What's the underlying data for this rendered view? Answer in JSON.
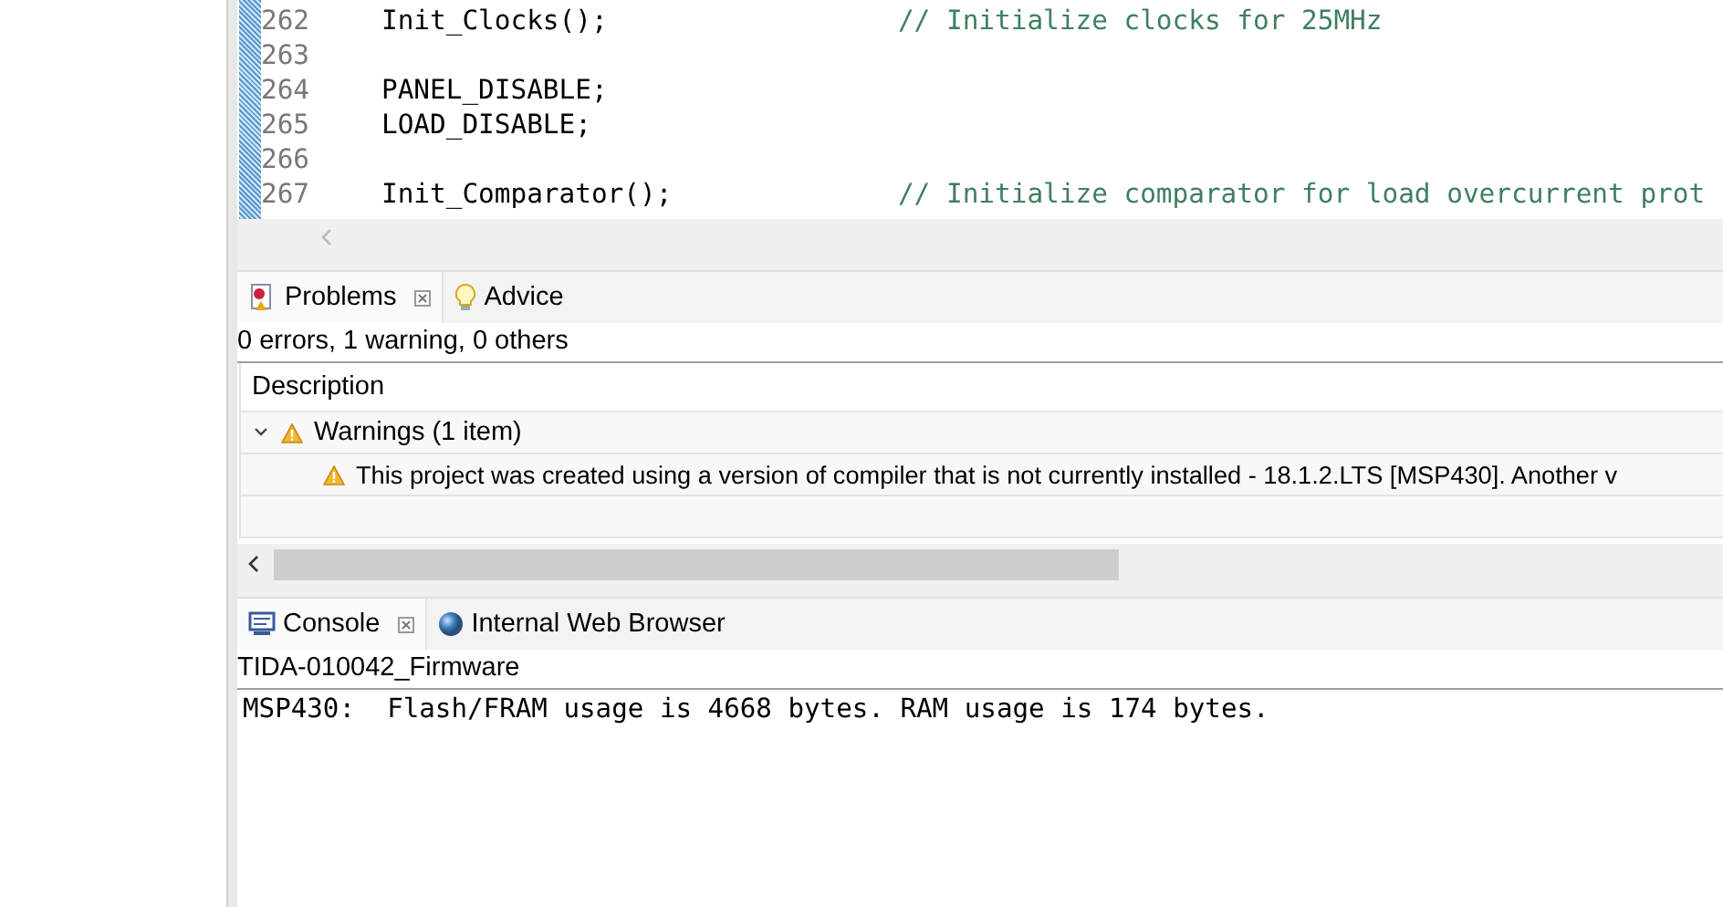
{
  "editor": {
    "lines": [
      {
        "number": "262",
        "code": "Init_Clocks();",
        "comment": "// Initialize clocks for 25MHz"
      },
      {
        "number": "263"
      },
      {
        "number": "264",
        "code": "PANEL_DISABLE;"
      },
      {
        "number": "265",
        "code": "LOAD_DISABLE;"
      },
      {
        "number": "266"
      },
      {
        "number": "267",
        "code": "Init_Comparator();",
        "comment": "// Initialize comparator for load overcurrent prot"
      }
    ]
  },
  "problems_view": {
    "tabs": [
      {
        "label": "Problems",
        "kind": "problems",
        "selected": true
      },
      {
        "label": "Advice",
        "kind": "bulb",
        "selected": false
      }
    ],
    "summary": "0 errors, 1 warning, 0 others",
    "columns": [
      "Description"
    ],
    "tree": [
      {
        "label": "Warnings (1 item)",
        "expanded": true,
        "children": [
          {
            "label": "This project was created using a version of compiler that is not currently installed - 18.1.2.LTS [MSP430]. Another v"
          }
        ]
      }
    ]
  },
  "console_view": {
    "tabs": [
      {
        "label": "Console",
        "kind": "console",
        "selected": true
      },
      {
        "label": "Internal Web Browser",
        "kind": "globe",
        "selected": false
      }
    ],
    "title": "TIDA-010042_Firmware",
    "output": [
      "MSP430:  Flash/FRAM usage is 4668 bytes. RAM usage is 174 bytes."
    ]
  }
}
